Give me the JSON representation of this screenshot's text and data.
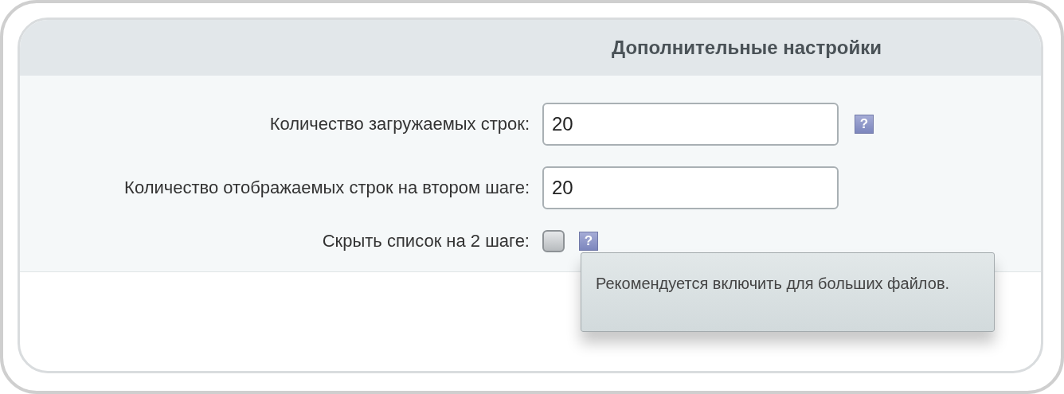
{
  "panel": {
    "title": "Дополнительные настройки"
  },
  "fields": [
    {
      "kind": "text",
      "label": "Количество загружаемых строк:",
      "value": "20",
      "help": "?"
    },
    {
      "kind": "text",
      "label": "Количество отображаемых строк на втором шаге:",
      "value": "20"
    },
    {
      "kind": "checkbox",
      "label": "Скрыть список на 2 шаге:",
      "checked": false,
      "help": "?",
      "tooltip": "Рекомендуется включить для больших файлов."
    }
  ]
}
